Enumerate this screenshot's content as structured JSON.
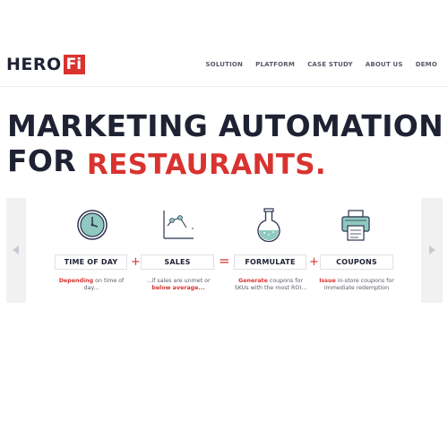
{
  "logo": {
    "text": "HERO",
    "box": "Fi"
  },
  "nav": [
    "SOLUTION",
    "PLATFORM",
    "CASE STUDY",
    "ABOUT US",
    "DEMO"
  ],
  "hero": {
    "line1": "MARKETING AUTOMATION",
    "line2_prefix": "FOR",
    "line2_accent": "RESTAURANTS."
  },
  "steps": [
    {
      "icon": "clock-icon",
      "label": "TIME OF DAY",
      "desc_bold": "Depending",
      "desc_rest": " on time of day..."
    },
    {
      "icon": "line-chart-icon",
      "label": "SALES",
      "desc_pre": "...if sales are unmet or ",
      "desc_bold": "below average..."
    },
    {
      "icon": "flask-icon",
      "label": "FORMULATE",
      "desc_bold": "Generate",
      "desc_rest": " coupons for SKUs with the most ROI..."
    },
    {
      "icon": "printer-icon",
      "label": "COUPONS",
      "desc_bold": "Issue",
      "desc_rest": " in-store coupons for immediate redemption"
    }
  ],
  "operators": [
    "+",
    "+",
    "=",
    "+"
  ],
  "colors": {
    "accent": "#d8332f",
    "dark": "#1f2233",
    "teal_icon": "#8fc9bf",
    "icon_stroke": "#2a3450",
    "panel_bg": "#f1f1f3"
  }
}
